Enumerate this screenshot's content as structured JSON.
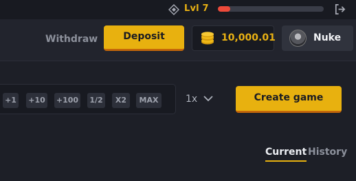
{
  "topbar": {
    "level_label": "Lvl 7",
    "xp_progress_percent": 12,
    "icons": {
      "level": "diamond-icon",
      "logout": "logout-icon"
    }
  },
  "header": {
    "withdraw_label": "Withdraw",
    "deposit_label": "Deposit",
    "balance": "10,000.01",
    "user_name": "Nuke",
    "icons": {
      "balance": "coin-stack-icon"
    }
  },
  "bet": {
    "chips": [
      "+1",
      "+10",
      "+100",
      "1/2",
      "X2",
      "MAX"
    ],
    "multiplier": "1x",
    "create_label": "Create game"
  },
  "tabs": {
    "current": "Current",
    "history": "History"
  },
  "colors": {
    "accent": "#e8b10f",
    "accent_shadow": "#c4670a",
    "xp_fill": "#ee4a3a",
    "background": "#1d1f27",
    "header": "#22242d"
  }
}
